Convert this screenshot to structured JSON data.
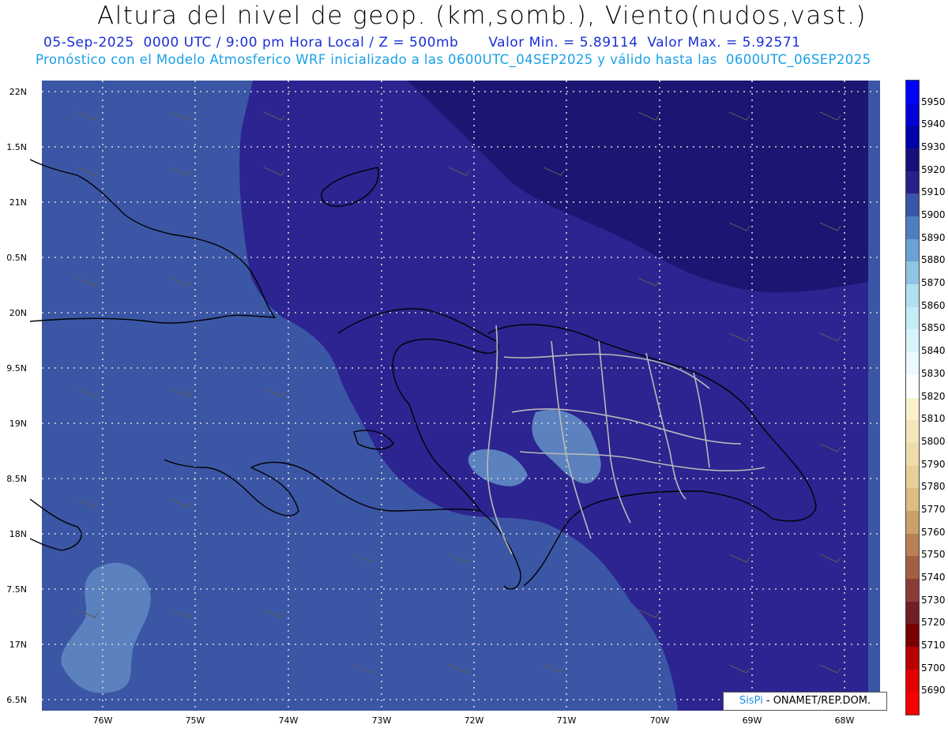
{
  "header": {
    "title": "Altura del nivel de geop. (km,somb.), Viento(nudos,vast.)",
    "subtitle_left": "05-Sep-2025  0000 UTC / 9:00 pm Hora Local / Z = 500mb",
    "subtitle_right": "Valor Min. = 5.89114  Valor Max. = 5.92571",
    "model_line": "Pronóstico con el Modelo Atmosferico WRF inicializado a las 0600UTC_04SEP2025 y válido hasta las  0600UTC_06SEP2025"
  },
  "axes": {
    "lat_labels": [
      "22N",
      "1.5N",
      "21N",
      "0.5N",
      "20N",
      "9.5N",
      "19N",
      "8.5N",
      "18N",
      "7.5N",
      "17N",
      "6.5N"
    ],
    "lon_labels": [
      "76W",
      "75W",
      "74W",
      "73W",
      "72W",
      "71W",
      "70W",
      "69W",
      "68W"
    ]
  },
  "colorbar": {
    "labels": [
      "5950",
      "5940",
      "5930",
      "5920",
      "5910",
      "5900",
      "5890",
      "5880",
      "5870",
      "5860",
      "5850",
      "5840",
      "5830",
      "5820",
      "5810",
      "5800",
      "5790",
      "5780",
      "5770",
      "5760",
      "5750",
      "5740",
      "5730",
      "5720",
      "5710",
      "5700",
      "5690"
    ],
    "colors": [
      "#0000ff",
      "#0000d8",
      "#0000a8",
      "#15107a",
      "#2a2088",
      "#3a56a8",
      "#4f7ec0",
      "#6aa2d4",
      "#8fc4e2",
      "#b0dff0",
      "#c4ecf6",
      "#d8f4fa",
      "#eafaff",
      "#ffffff",
      "#fbf1cc",
      "#f5e6bb",
      "#efdcab",
      "#e8cf98",
      "#ddbd82",
      "#cca06a",
      "#b98055",
      "#a35f44",
      "#8b3c36",
      "#731d24",
      "#7a0000",
      "#b80000",
      "#e20000",
      "#f80000"
    ]
  },
  "map": {
    "colors": {
      "ocean_low": "#3b56a5",
      "mid": "#2c2490",
      "high": "#1c1572",
      "light": "#5b82be",
      "coast": "#000000",
      "province": "#b9b9b9"
    }
  },
  "credit": {
    "sis": "SisPi",
    "text": " - ONAMET/REP.DOM."
  }
}
